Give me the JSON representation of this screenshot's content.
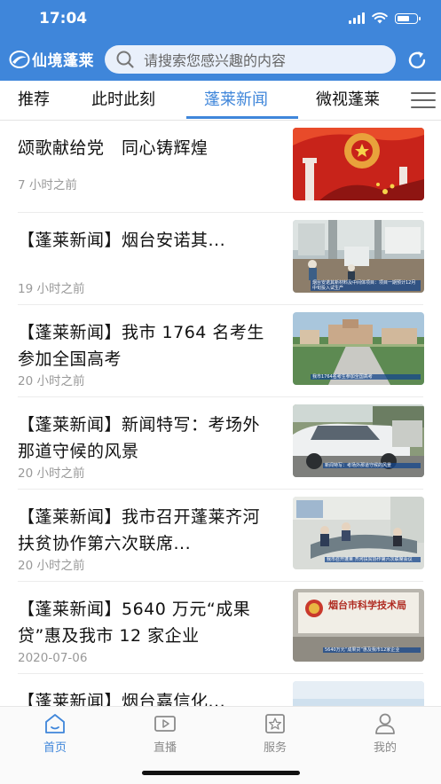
{
  "status": {
    "time": "17:04"
  },
  "header": {
    "app_name": "仙境蓬莱",
    "search_placeholder": "请搜索您感兴趣的内容",
    "brand_color": "#3f86da"
  },
  "tabs": [
    {
      "label": "推荐",
      "active": false
    },
    {
      "label": "此时此刻",
      "active": false
    },
    {
      "label": "蓬莱新闻",
      "active": true
    },
    {
      "label": "微视蓬莱",
      "active": false
    }
  ],
  "news": [
    {
      "title": "颂歌献给党　同心铸辉煌",
      "time": "7 小时之前",
      "thumb_caption": ""
    },
    {
      "title": "【蓬莱新闻】烟台安诺其...",
      "time": "19 小时之前",
      "thumb_caption": "烟台安诺其新材料及中间体项目：项目一期预计12月中旬投入试生产"
    },
    {
      "title": "【蓬莱新闻】我市 1764 名考生参加全国高考",
      "time": "20 小时之前",
      "thumb_caption": "我市1764名考生参加全国高考"
    },
    {
      "title": "【蓬莱新闻】新闻特写：考场外那道守候的风景",
      "time": "20 小时之前",
      "thumb_caption": "新闻特写：考场外那道守候的风景"
    },
    {
      "title": "【蓬莱新闻】我市召开蓬莱齐河扶贫协作第六次联席...",
      "time": "20 小时之前",
      "thumb_caption": "我市召开蓬莱 齐河扶贫协作第六次联席会议"
    },
    {
      "title": "【蓬莱新闻】5640 万元“成果贷”惠及我市 12 家企业",
      "time": "2020-07-06",
      "thumb_caption": "5640万元“成果贷”惠及我市12家企业",
      "thumb_sign": "烟台市科学技术局"
    },
    {
      "title": "【蓬莱新闻】烟台嘉信化...",
      "time": "",
      "thumb_caption": ""
    }
  ],
  "bottom_nav": [
    {
      "label": "首页",
      "icon": "home-icon",
      "active": true
    },
    {
      "label": "直播",
      "icon": "live-video-icon",
      "active": false
    },
    {
      "label": "服务",
      "icon": "service-star-icon",
      "active": false
    },
    {
      "label": "我的",
      "icon": "profile-icon",
      "active": false
    }
  ]
}
